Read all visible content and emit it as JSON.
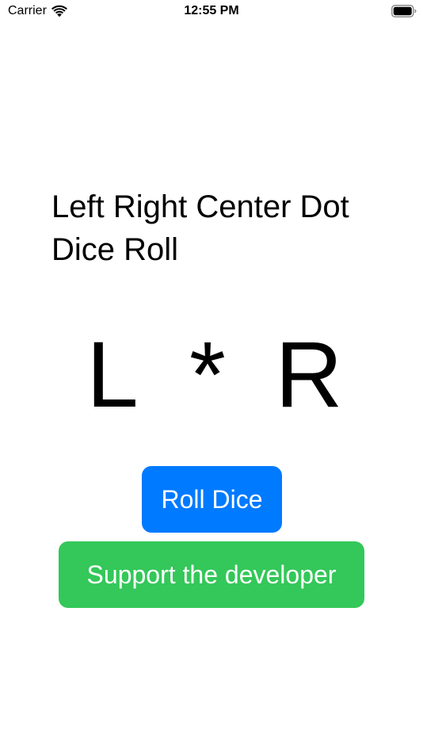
{
  "status_bar": {
    "carrier": "Carrier",
    "time": "12:55 PM",
    "icons": [
      "wifi-icon",
      "battery-icon"
    ]
  },
  "title_line1": "Left Right Center Dot",
  "title_line2": "Dice Roll",
  "dice": [
    "L",
    "*",
    "R"
  ],
  "buttons": {
    "roll_label": "Roll Dice",
    "support_label": "Support the developer"
  },
  "colors": {
    "roll_button": "#007aff",
    "support_button": "#34c759",
    "background": "#ffffff",
    "text": "#000000"
  }
}
